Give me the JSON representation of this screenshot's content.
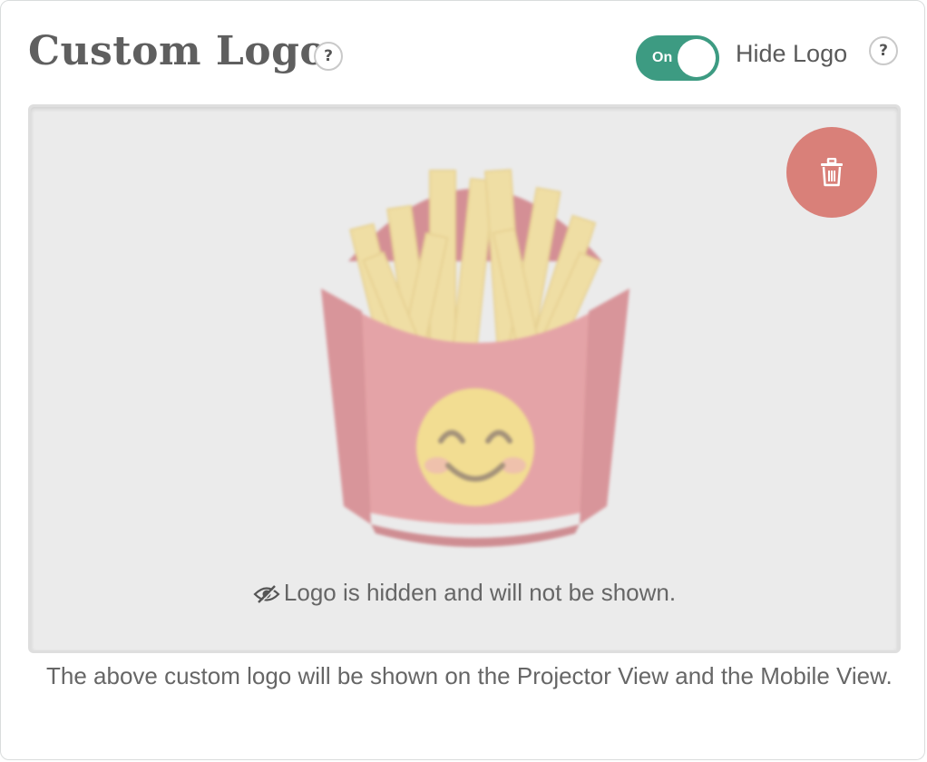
{
  "header": {
    "title": "Custom Logo",
    "title_help_glyph": "?",
    "toggle": {
      "state_label": "On",
      "checked": true,
      "color": "#3d9b82"
    },
    "hide_logo_label": "Hide Logo",
    "hide_help_glyph": "?"
  },
  "preview": {
    "logo_icon": "french-fries-icon",
    "delete_icon": "trash-icon",
    "delete_color": "#d98079",
    "hidden_icon": "eye-slash-icon",
    "hidden_message": "Logo is hidden and will not be shown."
  },
  "caption": "The above custom logo will be shown on the Projector View and the Mobile View."
}
